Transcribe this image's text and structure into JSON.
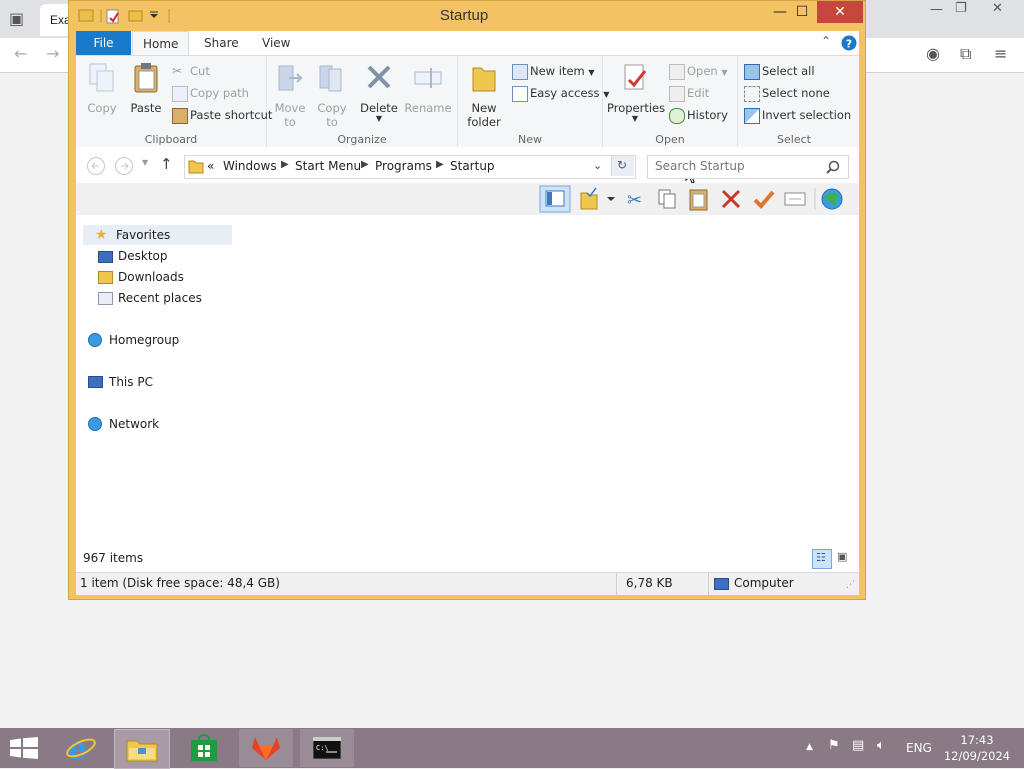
{
  "browser": {
    "tab_label": "Exa",
    "icons": [
      "tab-overview-icon",
      "back-icon",
      "forward-icon",
      "profile-icon",
      "extensions-icon",
      "menu-icon"
    ]
  },
  "window": {
    "title": "Startup",
    "qat": [
      "folder-icon",
      "properties-icon",
      "new-folder-icon",
      "customize-dropdown-icon"
    ],
    "controls": {
      "minimize": "—",
      "maximize": "☐",
      "close": "✕"
    }
  },
  "ribbon": {
    "tabs": [
      "File",
      "Home",
      "Share",
      "View"
    ],
    "active_tab": "Home",
    "groups": {
      "clipboard": {
        "label": "Clipboard",
        "copy": "Copy",
        "paste": "Paste",
        "cut": "Cut",
        "copy_path": "Copy path",
        "paste_shortcut": "Paste shortcut"
      },
      "organize": {
        "label": "Organize",
        "move_to_1": "Move",
        "move_to_2": "to",
        "copy_to_1": "Copy",
        "copy_to_2": "to",
        "delete": "Delete",
        "rename": "Rename"
      },
      "new": {
        "label": "New",
        "new_folder_1": "New",
        "new_folder_2": "folder",
        "new_item": "New item",
        "easy_access": "Easy access"
      },
      "open": {
        "label": "Open",
        "properties": "Properties",
        "open": "Open",
        "edit": "Edit",
        "history": "History"
      },
      "select": {
        "label": "Select",
        "select_all": "Select all",
        "select_none": "Select none",
        "invert": "Invert selection"
      }
    }
  },
  "address": {
    "prefix": "«",
    "crumbs": [
      "Windows",
      "Start Menu",
      "Programs",
      "Startup"
    ],
    "search_placeholder": "Search Startup"
  },
  "nav": {
    "favorites": "Favorites",
    "desktop": "Desktop",
    "downloads": "Downloads",
    "recent": "Recent places",
    "homegroup": "Homegroup",
    "thispc": "This PC",
    "network": "Network"
  },
  "status": {
    "items_count": "967 items",
    "selection": "1 item (Disk free space: 48,4 GB)",
    "size": "6,78 KB",
    "location": "Computer"
  },
  "taskbar": {
    "apps": [
      "internet-explorer-icon",
      "file-explorer-icon",
      "store-icon",
      "gitlab-icon",
      "command-prompt-icon"
    ],
    "lang": "ENG",
    "time": "17:43",
    "date": "12/09/2024"
  },
  "colors": {
    "window_frame": "#f3c262",
    "file_tab": "#1979ca",
    "close_button": "#c7463d",
    "taskbar": "#8a7a86"
  }
}
